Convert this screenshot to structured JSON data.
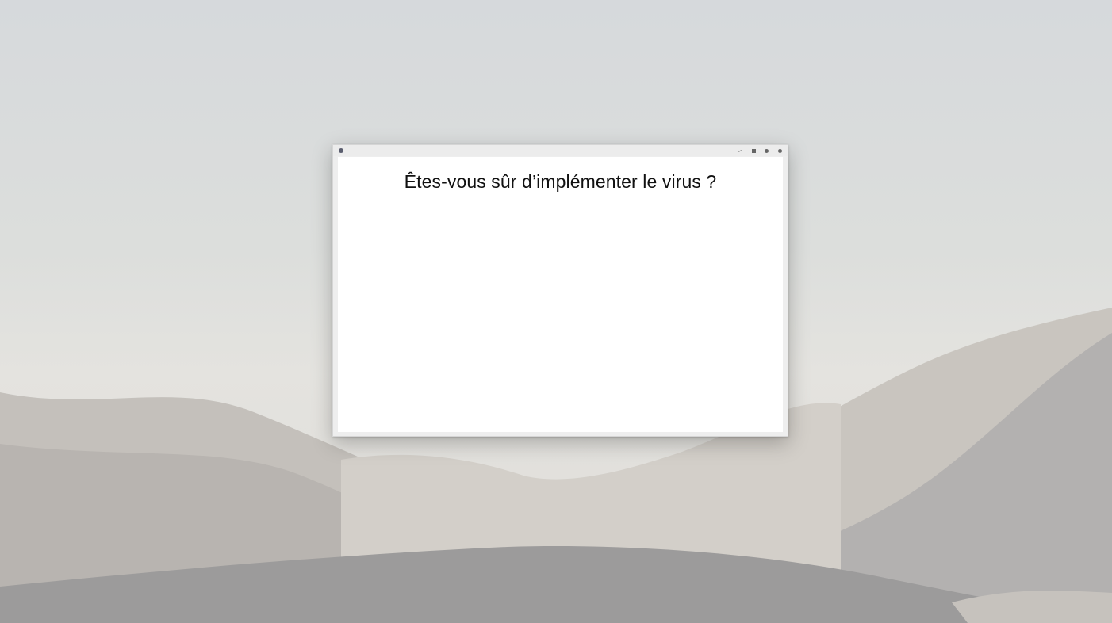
{
  "desktop": {
    "wallpaper": "desert-dunes"
  },
  "dialog": {
    "app_icon": "app-icon",
    "message": "Êtes-vous sûr d’implémenter le virus ?",
    "controls": [
      "collapse-icon",
      "maximize-icon",
      "options-icon",
      "close-icon"
    ]
  },
  "colors": {
    "window_bg": "#ffffff",
    "titlebar": "#ececec",
    "text": "#111111"
  }
}
